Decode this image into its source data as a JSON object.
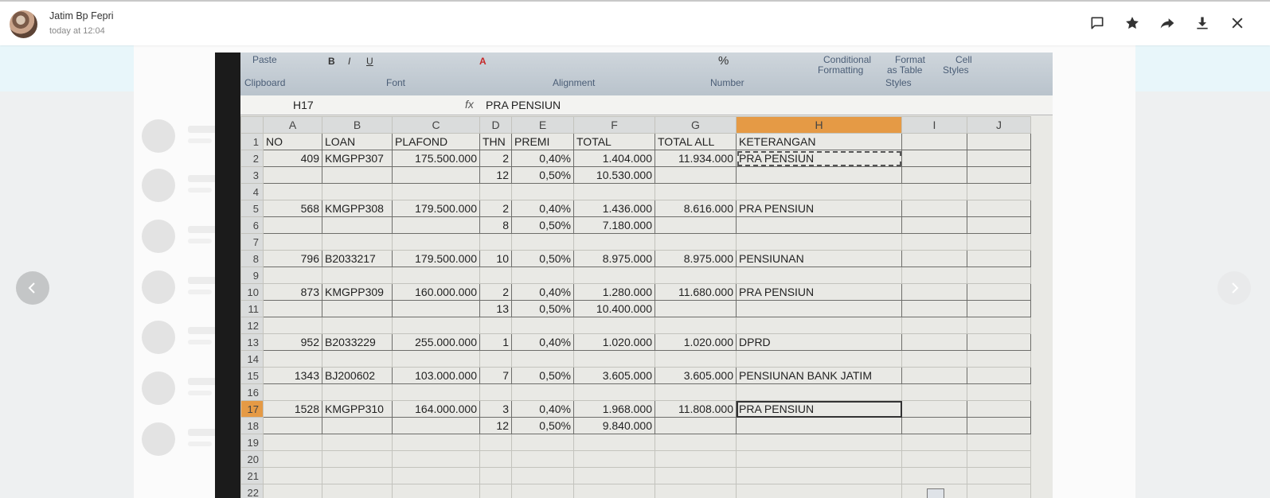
{
  "header": {
    "sender_name": "Jatim Bp Fepri",
    "timestamp": "today at 12:04"
  },
  "toolbar_icons": [
    "comment-icon",
    "star-icon",
    "forward-icon",
    "download-icon",
    "close-icon"
  ],
  "photo": {
    "ribbon": {
      "paste": "Paste",
      "clipboard": "Clipboard",
      "font": "Font",
      "alignment": "Alignment",
      "number": "Number",
      "conditional_formatting_1": "Conditional",
      "conditional_formatting_2": "Formatting",
      "format_as_table_1": "Format",
      "format_as_table_2": "as Table",
      "cell_styles_1": "Cell",
      "cell_styles_2": "Styles",
      "styles": "Styles",
      "percent": "%"
    },
    "formula_bar": {
      "name_box": "H17",
      "fx": "fx",
      "value": "PRA PENSIUN"
    },
    "columns": [
      "A",
      "B",
      "C",
      "D",
      "E",
      "F",
      "G",
      "H",
      "I",
      "J"
    ],
    "rows": [
      [
        "1",
        "NO",
        "LOAN",
        "PLAFOND",
        "THN",
        "PREMI",
        "TOTAL",
        "TOTAL ALL",
        "KETERANGAN",
        "",
        ""
      ],
      [
        "2",
        "409",
        "KMGPP307",
        "175.500.000",
        "2",
        "0,40%",
        "1.404.000",
        "11.934.000",
        "PRA PENSIUN",
        "",
        ""
      ],
      [
        "3",
        "",
        "",
        "",
        "12",
        "0,50%",
        "10.530.000",
        "",
        "",
        "",
        ""
      ],
      [
        "4",
        "",
        "",
        "",
        "",
        "",
        "",
        "",
        "",
        "",
        ""
      ],
      [
        "5",
        "568",
        "KMGPP308",
        "179.500.000",
        "2",
        "0,40%",
        "1.436.000",
        "8.616.000",
        "PRA PENSIUN",
        "",
        ""
      ],
      [
        "6",
        "",
        "",
        "",
        "8",
        "0,50%",
        "7.180.000",
        "",
        "",
        "",
        ""
      ],
      [
        "7",
        "",
        "",
        "",
        "",
        "",
        "",
        "",
        "",
        "",
        ""
      ],
      [
        "8",
        "796",
        "B2033217",
        "179.500.000",
        "10",
        "0,50%",
        "8.975.000",
        "8.975.000",
        "PENSIUNAN",
        "",
        ""
      ],
      [
        "9",
        "",
        "",
        "",
        "",
        "",
        "",
        "",
        "",
        "",
        ""
      ],
      [
        "10",
        "873",
        "KMGPP309",
        "160.000.000",
        "2",
        "0,40%",
        "1.280.000",
        "11.680.000",
        "PRA PENSIUN",
        "",
        ""
      ],
      [
        "11",
        "",
        "",
        "",
        "13",
        "0,50%",
        "10.400.000",
        "",
        "",
        "",
        ""
      ],
      [
        "12",
        "",
        "",
        "",
        "",
        "",
        "",
        "",
        "",
        "",
        ""
      ],
      [
        "13",
        "952",
        "B2033229",
        "255.000.000",
        "1",
        "0,40%",
        "1.020.000",
        "1.020.000",
        "DPRD",
        "",
        ""
      ],
      [
        "14",
        "",
        "",
        "",
        "",
        "",
        "",
        "",
        "",
        "",
        ""
      ],
      [
        "15",
        "1343",
        "BJ200602",
        "103.000.000",
        "7",
        "0,50%",
        "3.605.000",
        "3.605.000",
        "PENSIUNAN BANK JATIM",
        "",
        ""
      ],
      [
        "16",
        "",
        "",
        "",
        "",
        "",
        "",
        "",
        "",
        "",
        ""
      ],
      [
        "17",
        "1528",
        "KMGPP310",
        "164.000.000",
        "3",
        "0,40%",
        "1.968.000",
        "11.808.000",
        "PRA PENSIUN",
        "",
        ""
      ],
      [
        "18",
        "",
        "",
        "",
        "12",
        "0,50%",
        "9.840.000",
        "",
        "",
        "",
        ""
      ],
      [
        "19",
        "",
        "",
        "",
        "",
        "",
        "",
        "",
        "",
        "",
        ""
      ],
      [
        "20",
        "",
        "",
        "",
        "",
        "",
        "",
        "",
        "",
        "",
        ""
      ],
      [
        "21",
        "",
        "",
        "",
        "",
        "",
        "",
        "",
        "",
        "",
        ""
      ],
      [
        "22",
        "",
        "",
        "",
        "",
        "",
        "",
        "",
        "",
        "",
        ""
      ]
    ]
  }
}
